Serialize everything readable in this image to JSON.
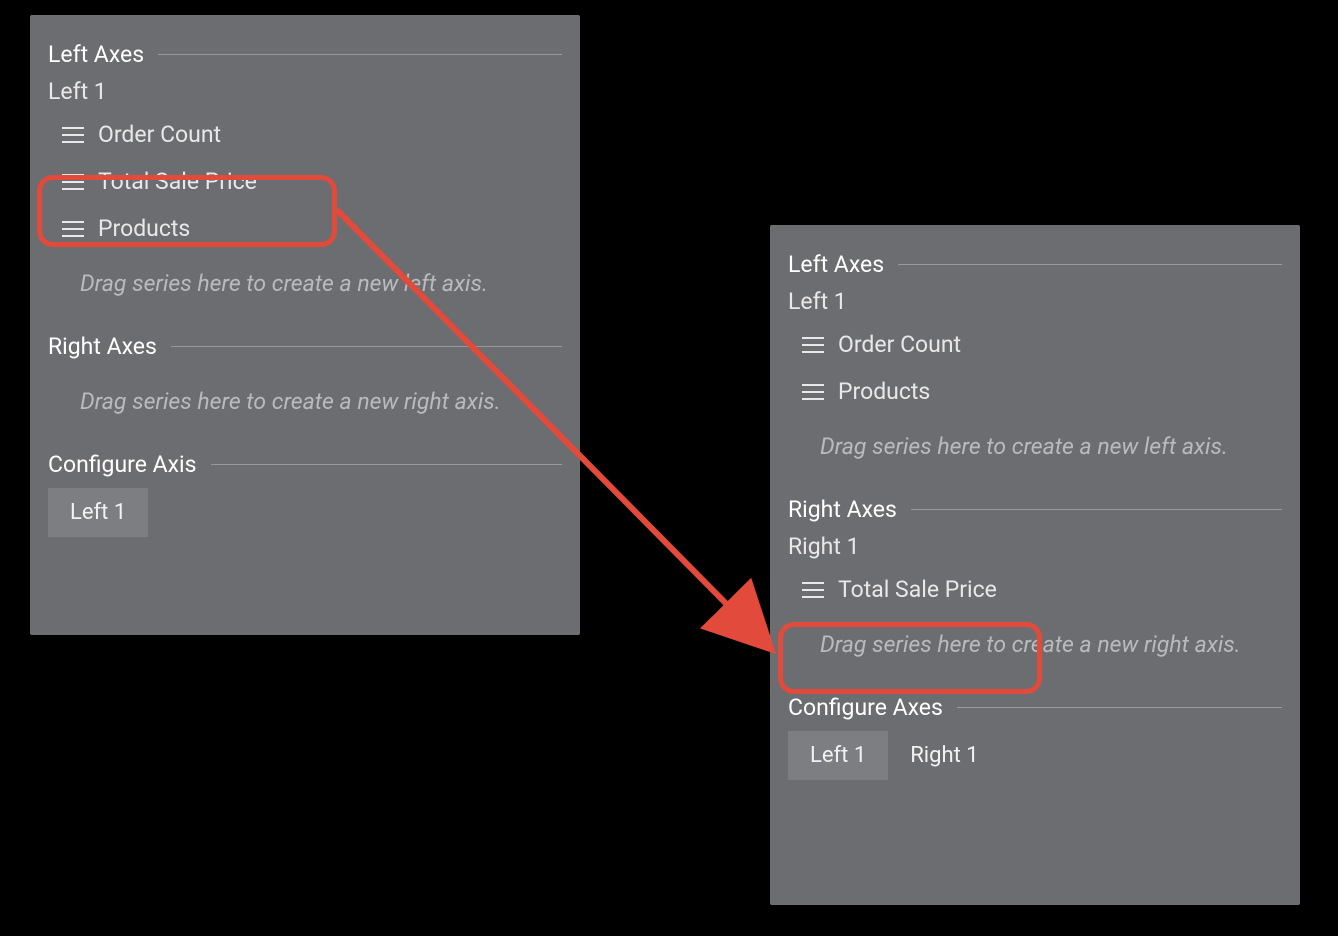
{
  "panelA": {
    "leftAxes": {
      "header": "Left Axes",
      "axisName": "Left 1",
      "series": [
        "Order Count",
        "Total Sale Price",
        "Products"
      ],
      "dropHint": "Drag series here to create a new left axis."
    },
    "rightAxes": {
      "header": "Right Axes",
      "dropHint": "Drag series here to create a new right axis."
    },
    "configure": {
      "header": "Configure Axis",
      "tabs": [
        "Left 1"
      ],
      "activeTab": 0
    }
  },
  "panelB": {
    "leftAxes": {
      "header": "Left Axes",
      "axisName": "Left 1",
      "series": [
        "Order Count",
        "Products"
      ],
      "dropHint": "Drag series here to create a new left axis."
    },
    "rightAxes": {
      "header": "Right Axes",
      "axisName": "Right 1",
      "series": [
        "Total Sale Price"
      ],
      "dropHint": "Drag series here to create a new right axis."
    },
    "configure": {
      "header": "Configure Axes",
      "tabs": [
        "Left 1",
        "Right 1"
      ],
      "activeTab": 0
    }
  },
  "annotation": {
    "highlightColor": "#e24a3b",
    "movedSeries": "Total Sale Price"
  }
}
